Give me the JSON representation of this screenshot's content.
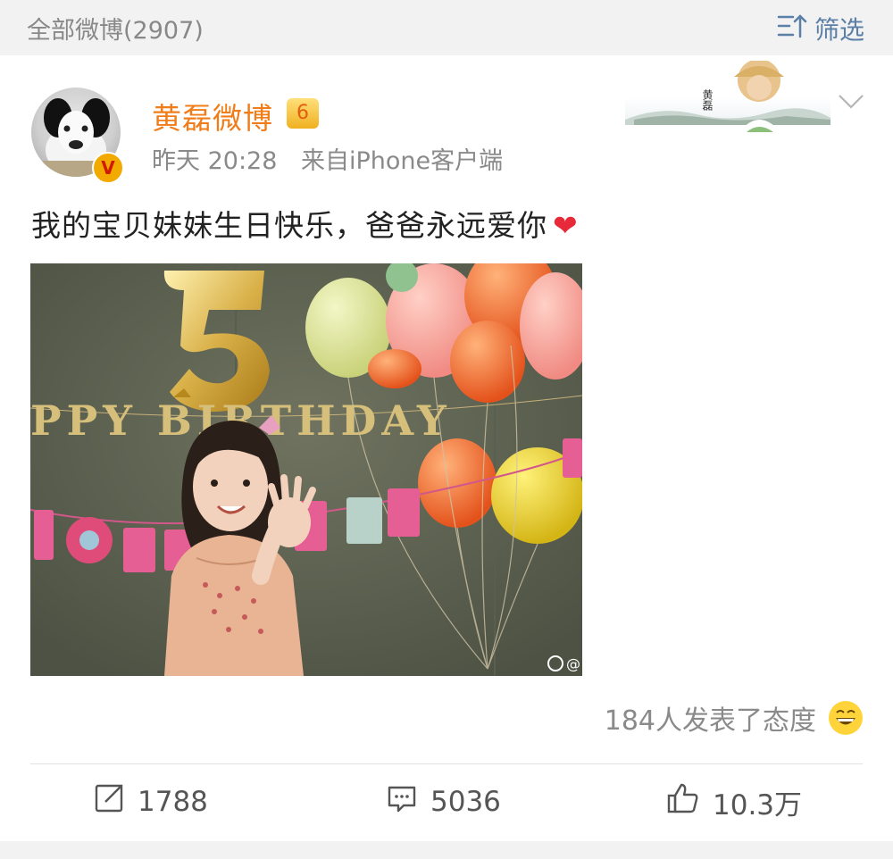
{
  "header": {
    "count_label": "全部微博(2907)",
    "filter_label": "筛选"
  },
  "post": {
    "username": "黄磊微博",
    "verified_badge": "V",
    "vip_badge": "6",
    "time": "昨天 20:28",
    "source": "来自iPhone客户端",
    "banner_text": "黄磊",
    "text": "我的宝贝妹妹生日快乐，爸爸永远爱你",
    "heart": "❤",
    "photo": {
      "banner_letters": "PPY BIRTHDAY",
      "watermark": "@"
    },
    "reactions_label": "184人发表了态度"
  },
  "actions": {
    "repost_count": "1788",
    "comment_count": "5036",
    "like_count": "10.3万"
  },
  "colors": {
    "username": "#f07d1a",
    "filter": "#5b7fa6",
    "heart": "#e8293a"
  }
}
